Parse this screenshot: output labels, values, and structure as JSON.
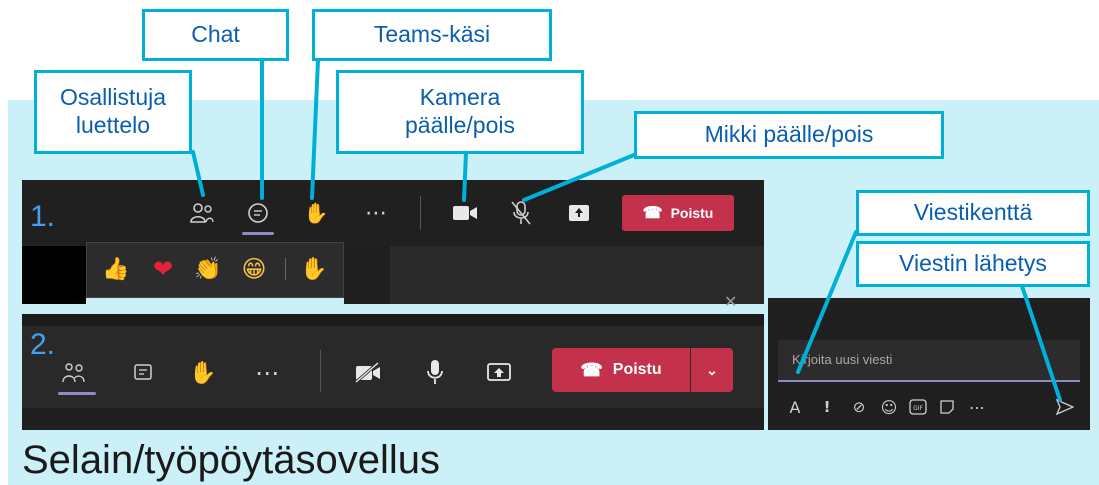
{
  "callouts": {
    "chat": "Chat",
    "raise_hand": "Teams-käsi",
    "participants_line1": "Osallistuja",
    "participants_line2": "luettelo",
    "camera_line1": "Kamera",
    "camera_line2": "päälle/pois",
    "mic": "Mikki päälle/pois",
    "message_field": "Viestikenttä",
    "send": "Viestin lähetys"
  },
  "toolbar1": {
    "number": "1.",
    "leave_label": "Poistu",
    "reactions": [
      "👍",
      "❤",
      "👏",
      "😁",
      "✋"
    ]
  },
  "toolbar2": {
    "number": "2.",
    "leave_label": "Poistu"
  },
  "chat_compose": {
    "placeholder": "Kirjoita uusi viesti",
    "tools": [
      "format-icon",
      "important-icon",
      "attach-icon",
      "emoji-icon",
      "gif-icon",
      "sticker-icon",
      "more-icon",
      "send-icon"
    ]
  },
  "footer": "Selain/työpöytäsovellus",
  "colors": {
    "accent": "#00b0d8",
    "callout_text": "#0a5eb0",
    "leave_red": "#c4314b",
    "background": "#ccf0f8"
  }
}
